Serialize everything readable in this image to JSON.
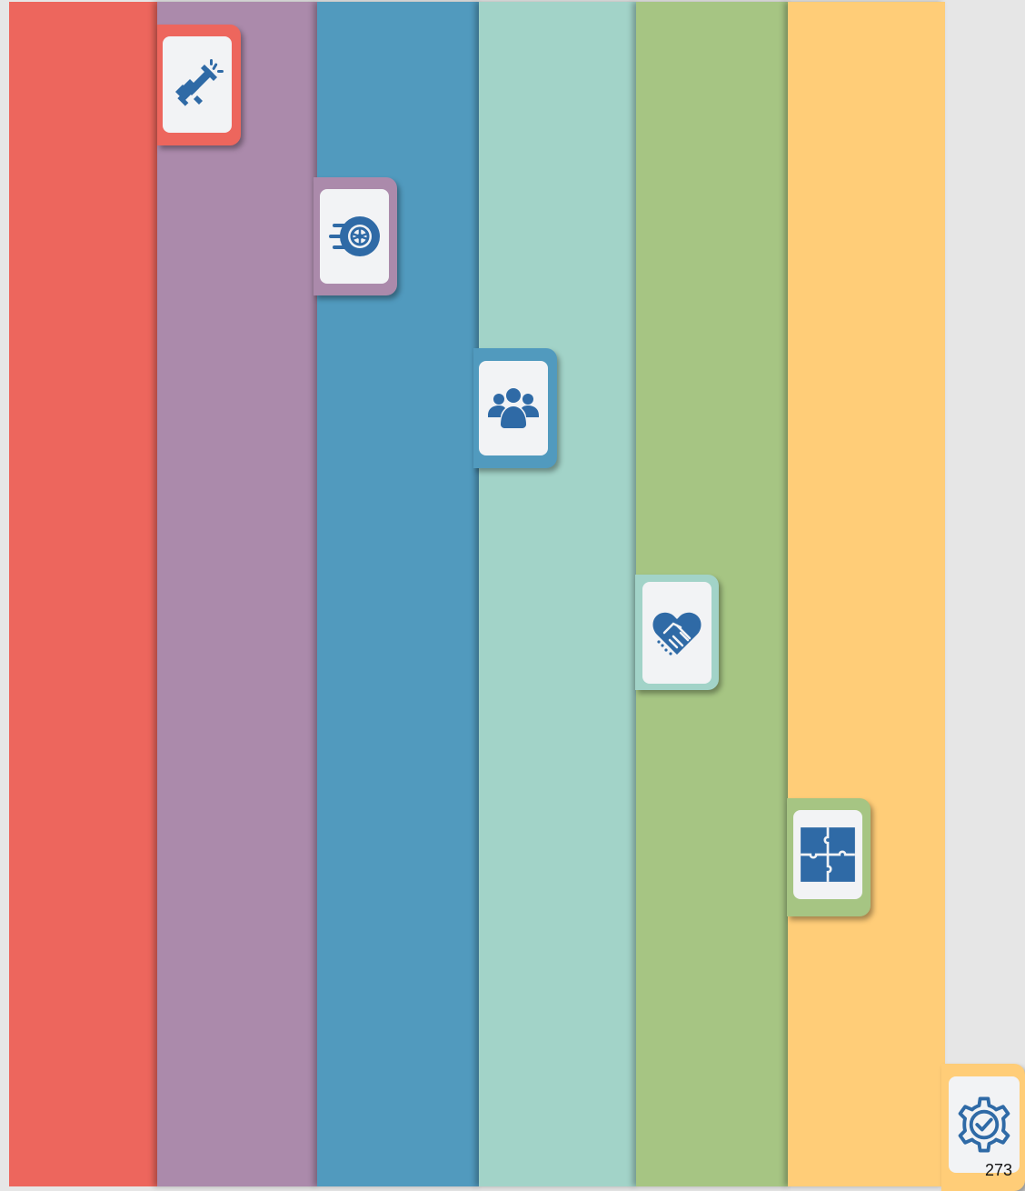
{
  "columns": [
    {
      "color": "#ed665d"
    },
    {
      "color": "#ab8aab"
    },
    {
      "color": "#519abe"
    },
    {
      "color": "#a2d3c8"
    },
    {
      "color": "#a6c583"
    },
    {
      "color": "#ffcd78"
    }
  ],
  "tabs": [
    {
      "icon": "megaphone-icon",
      "color": "#ed665d"
    },
    {
      "icon": "tire-icon",
      "color": "#ab8aab"
    },
    {
      "icon": "team-icon",
      "color": "#519abe"
    },
    {
      "icon": "heart-handshake-icon",
      "color": "#a2d3c8"
    },
    {
      "icon": "puzzle-icon",
      "color": "#a6c583"
    },
    {
      "icon": "gear-check-icon",
      "color": "#ffcd78"
    }
  ],
  "icon_color": "#2f6aa6",
  "page_number": "273"
}
